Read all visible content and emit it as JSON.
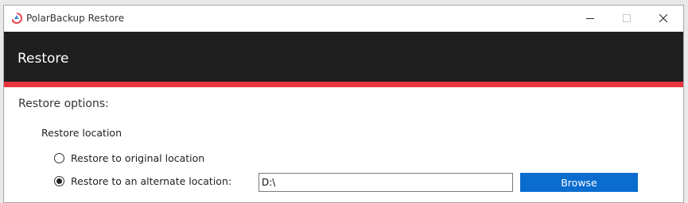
{
  "window": {
    "title": "PolarBackup Restore",
    "icon": "polarbackup-logo-icon",
    "controls": [
      "minimize-icon",
      "maximize-icon",
      "close-icon"
    ]
  },
  "header": {
    "title": "Restore",
    "background": "#1e1e1e",
    "accent_color": "#e8343f"
  },
  "options": {
    "section_title": "Restore options:",
    "location_label": "Restore location",
    "radios": [
      {
        "label": "Restore to original location",
        "checked": false
      },
      {
        "label": "Restore to an alternate location:",
        "checked": true
      }
    ],
    "path_value": "D:\\",
    "browse_label": "Browse",
    "browse_color": "#0a6ccf"
  }
}
